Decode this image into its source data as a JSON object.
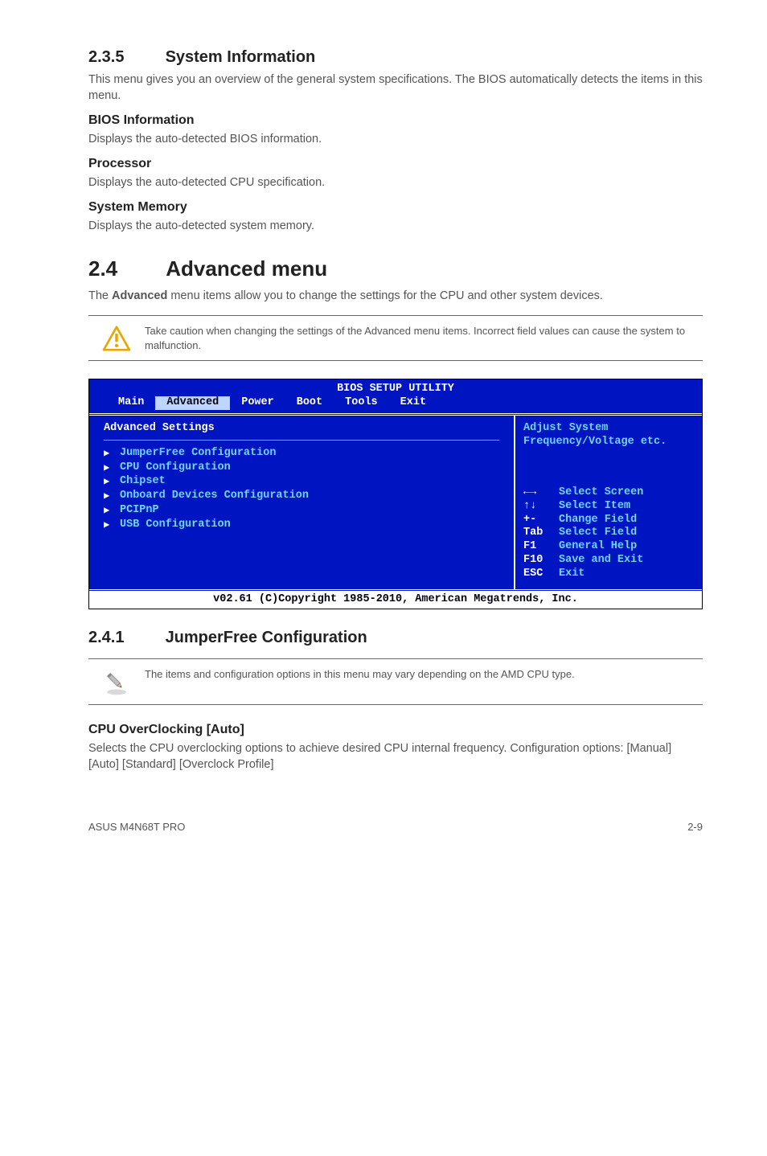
{
  "sec235": {
    "heading_num": "2.3.5",
    "heading_text": "System Information",
    "intro": "This menu gives you an overview of the general system specifications. The BIOS automatically detects the items in this menu.",
    "bios_info_h": "BIOS Information",
    "bios_info_p": "Displays the auto-detected BIOS information.",
    "proc_h": "Processor",
    "proc_p": "Displays the auto-detected CPU specification.",
    "mem_h": "System Memory",
    "mem_p": "Displays the auto-detected system memory."
  },
  "sec24": {
    "heading_num": "2.4",
    "heading_text": "Advanced menu",
    "intro_pre": "The ",
    "intro_bold": "Advanced",
    "intro_post": " menu items allow you to change the settings for the CPU and other system devices.",
    "caution": "Take caution when changing the settings of the Advanced menu items. Incorrect field values can cause the system to malfunction."
  },
  "bios": {
    "title": "BIOS SETUP UTILITY",
    "tabs": {
      "main": "Main",
      "advanced": "Advanced",
      "power": "Power",
      "boot": "Boot",
      "tools": "Tools",
      "exit": "Exit"
    },
    "panel_title": "Advanced Settings",
    "items": {
      "jumperfree": "JumperFree Configuration",
      "cpu": "CPU Configuration",
      "chipset": "Chipset",
      "onboard": "Onboard Devices Configuration",
      "pcipnp": "PCIPnP",
      "usb": "USB Configuration"
    },
    "help1": "Adjust System",
    "help2": "Frequency/Voltage etc.",
    "keys": {
      "lr_sym": "←→",
      "lr": "Select Screen",
      "ud_sym": "↑↓",
      "ud": "Select Item",
      "pm_sym": "+-",
      "pm": "Change Field",
      "tab_sym": "Tab",
      "tab": "Select Field",
      "f1_sym": "F1",
      "f1": "General Help",
      "f10_sym": "F10",
      "f10": "Save and Exit",
      "esc_sym": "ESC",
      "esc": "Exit"
    },
    "copyright": "v02.61 (C)Copyright 1985-2010, American Megatrends, Inc."
  },
  "sec241": {
    "heading_num": "2.4.1",
    "heading_text": "JumperFree Configuration",
    "note": "The items and configuration options in this menu may vary depending on the AMD CPU type.",
    "cpu_oc_h": "CPU OverClocking [Auto]",
    "cpu_oc_p": "Selects the CPU overclocking options to achieve desired CPU internal frequency. Configuration options: [Manual] [Auto] [Standard] [Overclock Profile]"
  },
  "footer": {
    "left": "ASUS M4N68T PRO",
    "right": "2-9"
  }
}
